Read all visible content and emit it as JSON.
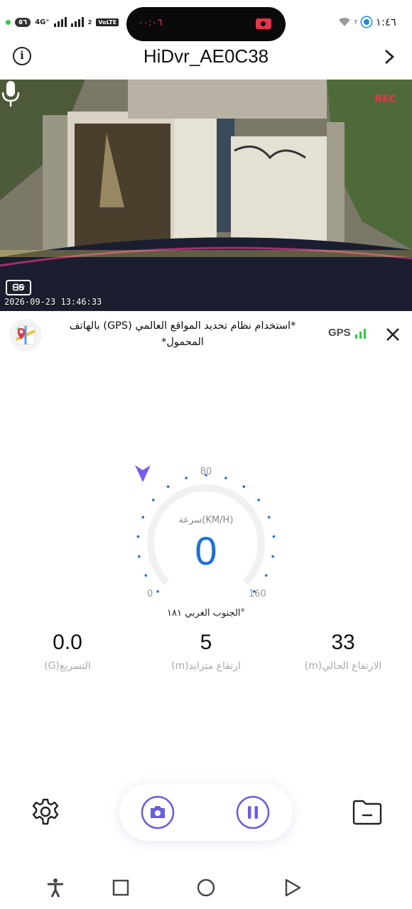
{
  "status_bar": {
    "battery": "٥٦",
    "network": "4G⁺",
    "sim2": "2",
    "volte": "VoLTE",
    "recording_timer": "٠٠:٠٦",
    "wifi_label": "?",
    "time": "١:٤٦"
  },
  "header": {
    "title": "HiDvr_AE0C38"
  },
  "camera": {
    "timestamp": "2026-09-23  13:46:33",
    "logo": "ᗺꞨ",
    "rec": "REC"
  },
  "gps_banner": {
    "text": "*استخدام نظام تحديد المواقع العالمي (GPS) بالهاتف المحمول*",
    "status_label": "GPS",
    "signal_bars": 3,
    "signal_color": "#2ecc40"
  },
  "speedometer": {
    "unit_label": "(KM/H)سرعة",
    "speed": "0",
    "scale_min": "0",
    "scale_mid": "80",
    "scale_max": "160",
    "direction": "°الجنوب الغربي ١٨١",
    "accent_color": "#1e6fd9",
    "arrow_color": "#7a5af8"
  },
  "stats": [
    {
      "value": "0.0",
      "label": "التسريع(G)"
    },
    {
      "value": "5",
      "label": "ارتفاع متزايد(m)"
    },
    {
      "value": "33",
      "label": "الارتفاع الحالي(m)"
    }
  ],
  "controls": {
    "settings_icon": "gear-icon",
    "snapshot_icon": "camera-icon",
    "pause_icon": "pause-icon",
    "files_icon": "folder-icon",
    "button_color": "#6a5fd8"
  },
  "navbar": {
    "accessibility_icon": "accessibility-icon",
    "recents_icon": "square-icon",
    "home_icon": "circle-icon",
    "back_icon": "triangle-icon"
  }
}
